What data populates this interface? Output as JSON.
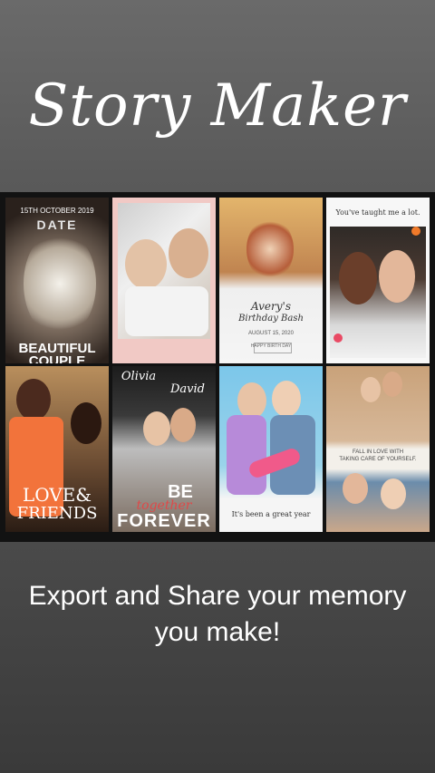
{
  "header": {
    "title": "Story Maker"
  },
  "tiles": [
    {
      "lines": [
        "15TH OCTOBER 2019",
        "DATE",
        "BEAUTIFUL",
        "COUPLE"
      ]
    },
    {
      "lines": []
    },
    {
      "lines": [
        "Avery's",
        "Birthday Bash",
        "AUGUST 15, 2020",
        "HAPPY BIRTH DAY"
      ]
    },
    {
      "lines": [
        "You've taught me a lot."
      ]
    },
    {
      "lines": [
        "LOVE&",
        "FRIENDS"
      ]
    },
    {
      "lines": [
        "Olivia",
        "David",
        "BE",
        "together",
        "FOREVER"
      ]
    },
    {
      "lines": [
        "It's been a great year"
      ]
    },
    {
      "lines": [
        "FALL IN LOVE WITH",
        "TAKING CARE OF YOURSELF."
      ]
    }
  ],
  "footer": {
    "caption_line1": "Export and Share your memory",
    "caption_line2": "you make!"
  }
}
